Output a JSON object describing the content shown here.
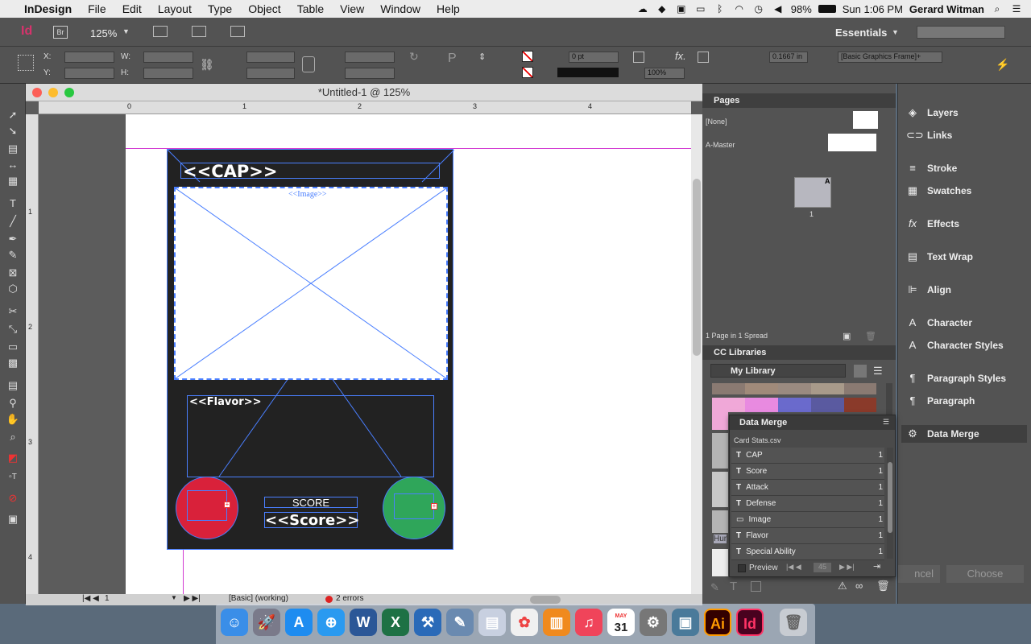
{
  "menubar": {
    "app": "InDesign",
    "items": [
      "File",
      "Edit",
      "Layout",
      "Type",
      "Object",
      "Table",
      "View",
      "Window",
      "Help"
    ],
    "battery": "98%",
    "clock": "Sun 1:06 PM",
    "user": "Gerard Witman"
  },
  "appbar": {
    "zoom": "125%",
    "workspace": "Essentials"
  },
  "control": {
    "x_label": "X:",
    "y_label": "Y:",
    "w_label": "W:",
    "h_label": "H:",
    "stroke_weight": "0 pt",
    "opacity": "100%",
    "offset": "0.1667 in",
    "object_style": "[Basic Graphics Frame]+"
  },
  "document": {
    "title": "*Untitled-1 @ 125%",
    "ruler_h": [
      "0",
      "1",
      "2",
      "3",
      "4"
    ],
    "ruler_v": [
      "1",
      "2",
      "3",
      "4"
    ],
    "card": {
      "cap": "<<CAP>>",
      "image": "<<Image>>",
      "flavor": "<<Flavor>>",
      "score_label": "SCORE",
      "score": "<<Score>>"
    },
    "status": {
      "page": "1",
      "profile": "[Basic] (working)",
      "errors": "2 errors"
    }
  },
  "pages": {
    "title": "Pages",
    "none": "[None]",
    "master": "A-Master",
    "thumb_label": "1",
    "master_badge": "A",
    "footer": "1 Page in 1 Spread"
  },
  "cclib": {
    "title": "CC Libraries",
    "library": "My Library",
    "colors": [
      "#8a7a72",
      "#a08a7a",
      "#9a8a80",
      "#a89a8a",
      "#8a7a72",
      "#f0a8d8",
      "#e88ae0",
      "#6a6acc",
      "#5a5aa0",
      "#8a3a2a"
    ],
    "hint": "Hur"
  },
  "datamerge": {
    "title": "Data Merge",
    "source": "Card Stats.csv",
    "fields": [
      {
        "name": "CAP",
        "count": "1",
        "type": "T"
      },
      {
        "name": "Score",
        "count": "1",
        "type": "T"
      },
      {
        "name": "Attack",
        "count": "1",
        "type": "T"
      },
      {
        "name": "Defense",
        "count": "1",
        "type": "T"
      },
      {
        "name": "Image",
        "count": "1",
        "type": "img"
      },
      {
        "name": "Flavor",
        "count": "1",
        "type": "T"
      },
      {
        "name": "Special Ability",
        "count": "1",
        "type": "T"
      }
    ],
    "preview": "Preview",
    "record": "45"
  },
  "right_panels": [
    "Layers",
    "Links",
    "Stroke",
    "Swatches",
    "Effects",
    "Text Wrap",
    "Align",
    "Character",
    "Character Styles",
    "Paragraph Styles",
    "Paragraph",
    "Data Merge"
  ],
  "dialog_buttons": {
    "cancel": "ncel",
    "choose": "Choose"
  },
  "dock": {
    "apps": [
      "Finder",
      "Launchpad",
      "App Store",
      "Safari",
      "Word",
      "Excel",
      "Xcode",
      "Preview",
      "Photos",
      "Photos2",
      "iBooks",
      "iTunes",
      "Calendar",
      "System Preferences",
      "Image Capture",
      "Illustrator",
      "InDesign",
      "Trash"
    ],
    "calendar_month": "MAY",
    "calendar_day": "31",
    "ai": "Ai",
    "id": "Id",
    "word": "W",
    "excel": "X"
  }
}
